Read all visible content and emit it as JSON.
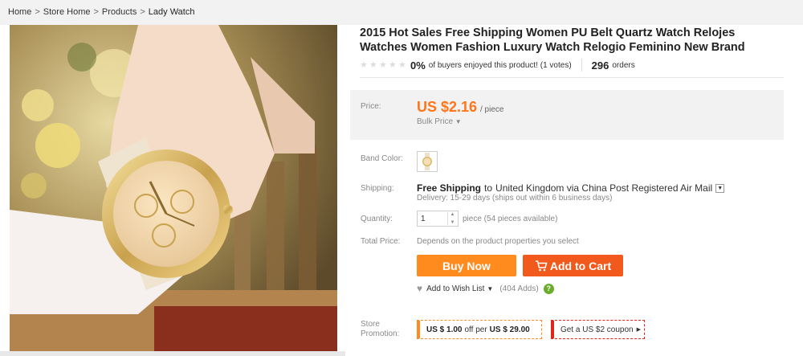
{
  "breadcrumb": {
    "items": [
      "Home",
      "Store Home",
      "Products",
      "Lady Watch"
    ],
    "separator": ">"
  },
  "product": {
    "title": "2015 Hot Sales Free Shipping Women PU Belt Quartz Watch Relojes Watches Women Fashion Luxury Watch Relogio Feminino New Brand",
    "rating_percent": "0%",
    "rating_text": "of buyers enjoyed this product! (1 votes)",
    "orders_count": "296",
    "orders_label": "orders"
  },
  "price": {
    "label": "Price:",
    "value": "US $2.16",
    "unit": "/ piece",
    "bulk_label": "Bulk Price"
  },
  "band_color": {
    "label": "Band Color:"
  },
  "shipping": {
    "label": "Shipping:",
    "free": "Free Shipping",
    "to": "to",
    "destination": "United Kingdom via China Post Registered Air Mail",
    "delivery": "Delivery: 15-29 days (ships out within 6 business days)"
  },
  "quantity": {
    "label": "Quantity:",
    "value": "1",
    "available": "piece (54 pieces available)"
  },
  "total": {
    "label": "Total Price:",
    "text": "Depends on the product properties you select"
  },
  "actions": {
    "buy_now": "Buy Now",
    "add_to_cart": "Add to Cart",
    "wishlist": "Add to Wish List",
    "wishlist_adds": "(404 Adds)",
    "help": "?"
  },
  "promotion": {
    "label_line1": "Store",
    "label_line2": "Promotion:",
    "coupon1_amount": "US $ 1.00",
    "coupon1_mid": "off per",
    "coupon1_min": "US $ 29.00",
    "coupon2": "Get a US $2 coupon"
  },
  "colors": {
    "price": "#ff7519",
    "buy_now": "#ff8a1e",
    "add_to_cart": "#f15a1c",
    "help": "#6aad2a"
  },
  "icons": [
    "cart-icon",
    "heart-icon",
    "chevron-down-icon",
    "help-icon"
  ]
}
